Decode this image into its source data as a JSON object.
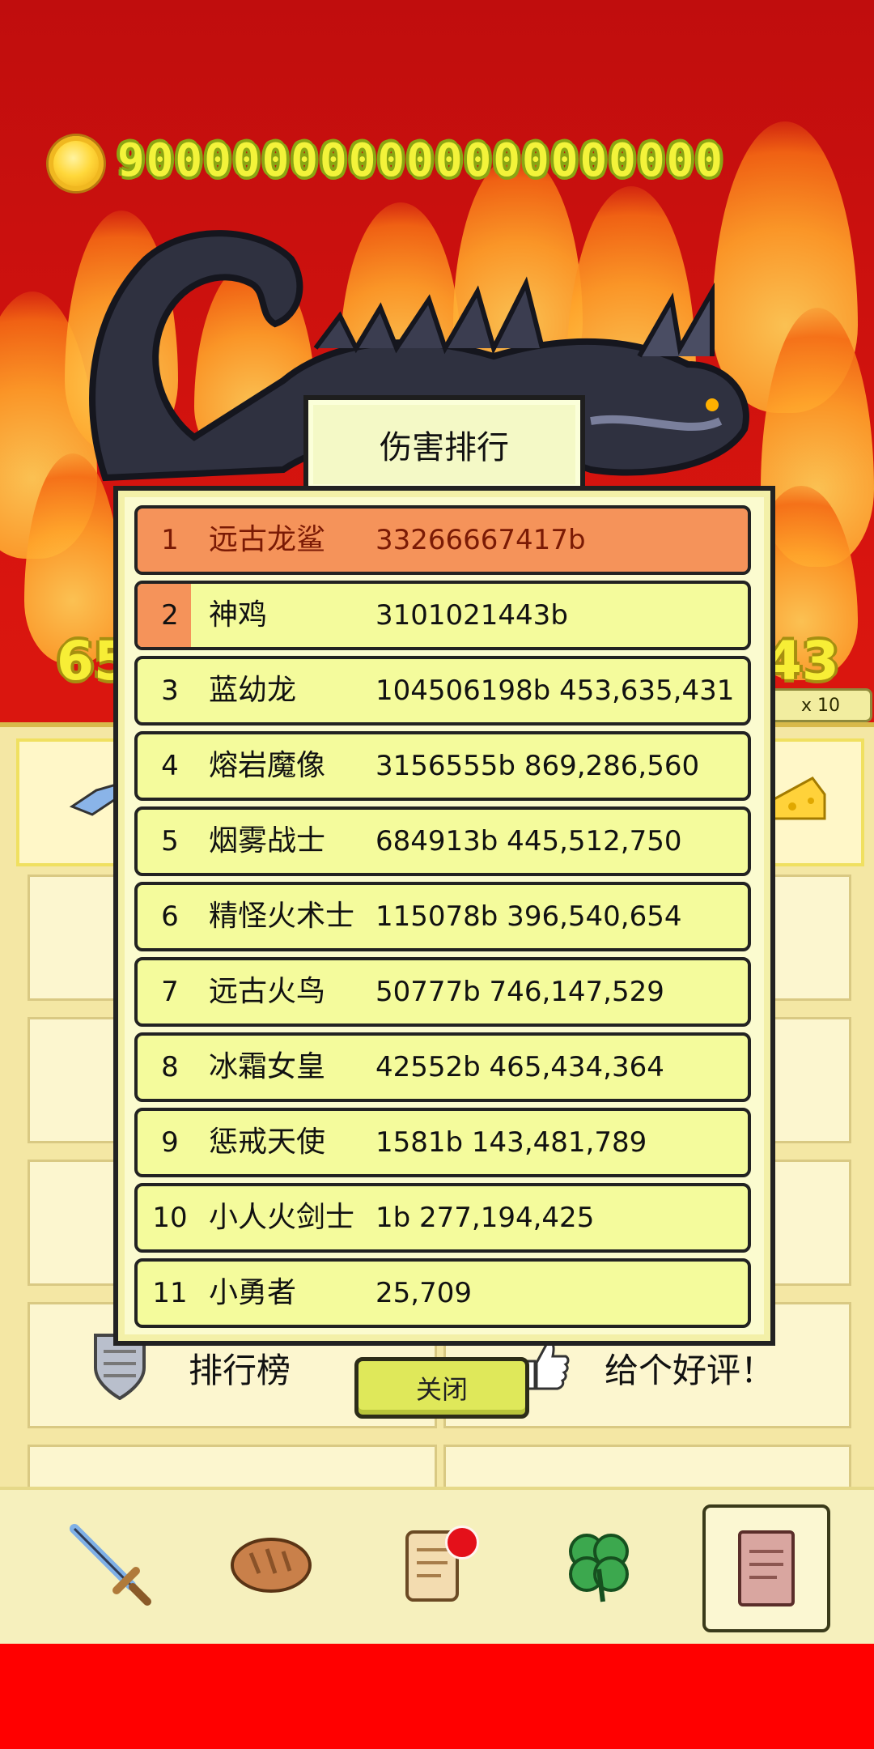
{
  "header": {
    "coin_icon": "gold-coin-icon",
    "coins": "900000000000000000000"
  },
  "background": {
    "left_number": "65",
    "right_number": "43",
    "multiplier_label": "x 10"
  },
  "shop": {
    "leaderboard_label": "排行榜",
    "rate_label": "给个好评！"
  },
  "leaderboard": {
    "title": "伤害排行",
    "rows": [
      {
        "rank": "1",
        "name": "远古龙鲨",
        "score": "33266667417b"
      },
      {
        "rank": "2",
        "name": "神鸡",
        "score": "3101021443b"
      },
      {
        "rank": "3",
        "name": "蓝幼龙",
        "score": "104506198b 453,635,431"
      },
      {
        "rank": "4",
        "name": "熔岩魔像",
        "score": "3156555b 869,286,560"
      },
      {
        "rank": "5",
        "name": "烟雾战士",
        "score": "684913b 445,512,750"
      },
      {
        "rank": "6",
        "name": "精怪火术士",
        "score": "115078b 396,540,654"
      },
      {
        "rank": "7",
        "name": "远古火鸟",
        "score": "50777b 746,147,529"
      },
      {
        "rank": "8",
        "name": "冰霜女皇",
        "score": "42552b 465,434,364"
      },
      {
        "rank": "9",
        "name": "惩戒天使",
        "score": "1581b 143,481,789"
      },
      {
        "rank": "10",
        "name": "小人火剑士",
        "score": "1b 277,194,425"
      },
      {
        "rank": "11",
        "name": "小勇者",
        "score": "25,709"
      }
    ],
    "close_label": "关闭"
  },
  "tabs": [
    {
      "icon": "sword-icon"
    },
    {
      "icon": "bread-icon"
    },
    {
      "icon": "scroll-icon"
    },
    {
      "icon": "clover-icon"
    },
    {
      "icon": "book-icon",
      "active": true
    }
  ],
  "colors": {
    "first_row": "#f5935a",
    "second_rank": "#f5935a",
    "row_bg": "#f4fb9c",
    "accent_text": "#f3f33a"
  }
}
